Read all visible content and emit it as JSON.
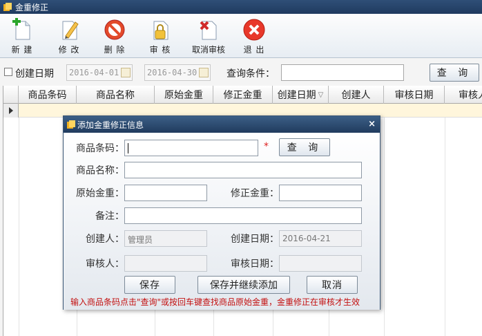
{
  "window": {
    "title": "金重修正"
  },
  "toolbar": {
    "new": "新 建",
    "edit": "修 改",
    "delete": "删 除",
    "approve": "审 核",
    "cancel_approve": "取消审核",
    "exit": "退 出"
  },
  "filter": {
    "created_date_label": "创建日期",
    "date_from": "2016-04-01",
    "date_to": "2016-04-30",
    "query_condition_label": "查询条件：",
    "query_value": "",
    "search_button": "查 询"
  },
  "grid": {
    "columns": [
      "商品条码",
      "商品名称",
      "原始金重",
      "修正金重",
      "创建日期",
      "创建人",
      "审核日期",
      "审核人"
    ],
    "sort_indicator": "▽"
  },
  "dialog": {
    "title": "添加金重修正信息",
    "close": "×",
    "barcode_label": "商品条码：",
    "barcode_value": "",
    "required_mark": "*",
    "query_button": "查 询",
    "name_label": "商品名称：",
    "name_value": "",
    "orig_weight_label": "原始金重：",
    "orig_weight_value": "",
    "fixed_weight_label": "修正金重：",
    "fixed_weight_value": "",
    "remark_label": "备注：",
    "remark_value": "",
    "creator_label": "创建人：",
    "creator_value": "管理员",
    "create_date_label": "创建日期：",
    "create_date_value": "2016-04-21",
    "approver_label": "审核人：",
    "approver_value": "",
    "approve_date_label": "审核日期：",
    "approve_date_value": "",
    "save_button": "保存",
    "save_continue_button": "保存并继续添加",
    "cancel_button": "取消",
    "hint": "输入商品条码点击\"查询\"或按回车键查找商品原始金重，金重修正在审核才生效"
  },
  "colors": {
    "title_bg": "#203b5e",
    "hint": "#c31010",
    "row_highlight": "#fff6dc"
  }
}
